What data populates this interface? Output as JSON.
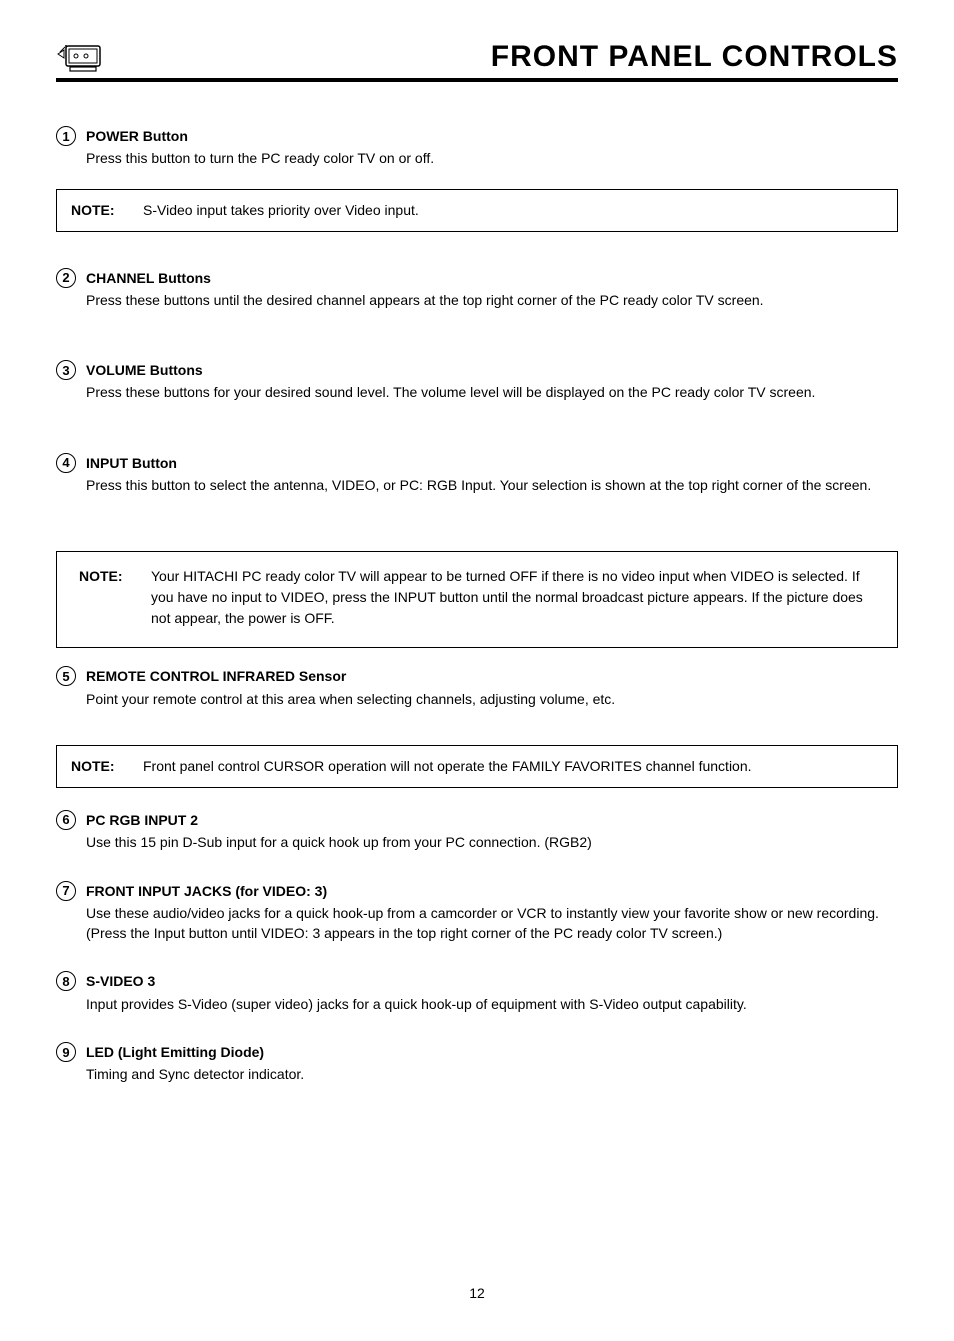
{
  "header": {
    "title": "FRONT PANEL CONTROLS"
  },
  "items": [
    {
      "num": "1",
      "title": "POWER Button",
      "desc": "Press this button to turn the PC ready color TV on or off."
    },
    {
      "num": "2",
      "title": "CHANNEL Buttons",
      "desc": "Press these buttons until the desired channel appears at the top right corner of the PC ready color TV screen."
    },
    {
      "num": "3",
      "title": "VOLUME Buttons",
      "desc": "Press these buttons for your desired sound level. The volume level will be displayed on the PC ready color TV screen."
    },
    {
      "num": "4",
      "title": "INPUT Button",
      "desc": "Press this button to select the antenna, VIDEO, or PC: RGB Input.  Your selection is shown at the top right corner of the screen."
    },
    {
      "num": "5",
      "title": "REMOTE CONTROL INFRARED Sensor",
      "desc": "Point your remote control at this area when selecting channels, adjusting volume, etc."
    },
    {
      "num": "6",
      "title": "PC RGB INPUT 2",
      "desc": "Use this 15 pin D-Sub input for a  quick  hook up from your PC connection. (RGB2)"
    },
    {
      "num": "7",
      "title": "FRONT INPUT JACKS (for VIDEO: 3)",
      "desc": "Use these audio/video jacks for a  quick  hook-up from a camcorder or VCR to instantly view your favorite show or new recording.  (Press the Input button until VIDEO: 3 appears in the top right corner of the PC ready color TV screen.)"
    },
    {
      "num": "8",
      "title": "S-VIDEO 3",
      "desc": "Input provides S-Video (super video) jacks for a  quick  hook-up of equipment with S-Video output capability."
    },
    {
      "num": "9",
      "title": "LED (Light Emitting Diode)",
      "desc": "Timing and Sync detector indicator."
    }
  ],
  "notes": [
    {
      "label": "NOTE:",
      "text": "S-Video input takes priority over Video input."
    },
    {
      "label": "NOTE:",
      "text": "Your HITACHI PC ready color TV will appear to be turned OFF if there is no video input when VIDEO is selected. If you have no input to VIDEO, press the INPUT button until the normal broadcast picture appears. If the picture does not appear, the power is OFF."
    },
    {
      "label": "NOTE:",
      "text": "Front panel control CURSOR operation will not operate the FAMILY FAVORITES channel function."
    }
  ],
  "page_number": "12"
}
